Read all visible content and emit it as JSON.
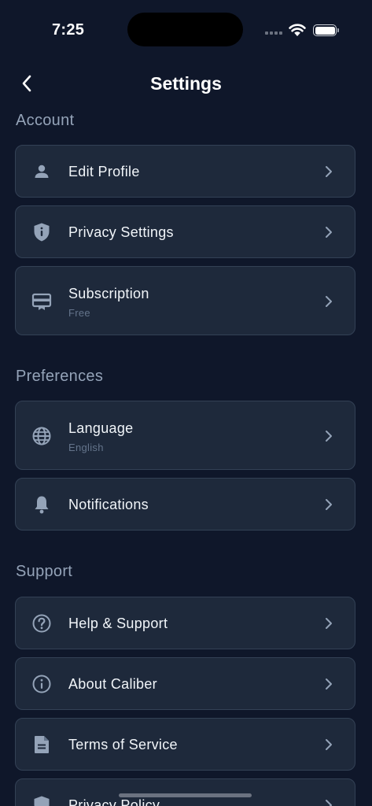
{
  "status_bar": {
    "time": "7:25"
  },
  "header": {
    "title": "Settings"
  },
  "sections": {
    "account": {
      "title": "Account",
      "edit_profile": {
        "label": "Edit Profile",
        "icon": "person-icon"
      },
      "privacy_settings": {
        "label": "Privacy Settings",
        "icon": "shield-icon"
      },
      "subscription": {
        "label": "Subscription",
        "sub": "Free",
        "icon": "card-icon"
      }
    },
    "preferences": {
      "title": "Preferences",
      "language": {
        "label": "Language",
        "sub": "English",
        "icon": "globe-icon"
      },
      "notifications": {
        "label": "Notifications",
        "icon": "bell-icon"
      }
    },
    "support": {
      "title": "Support",
      "help_support": {
        "label": "Help & Support",
        "icon": "question-icon"
      },
      "about": {
        "label": "About Caliber",
        "icon": "info-icon"
      },
      "terms": {
        "label": "Terms of Service",
        "icon": "document-icon"
      },
      "privacy_policy": {
        "label": "Privacy Policy",
        "icon": "shield-icon"
      }
    }
  },
  "colors": {
    "background": "#0f172a",
    "card": "#1e293b",
    "card_border": "#334155",
    "section_title": "#94a3b8",
    "icon": "#94a3b8",
    "subtext": "#64748b"
  }
}
